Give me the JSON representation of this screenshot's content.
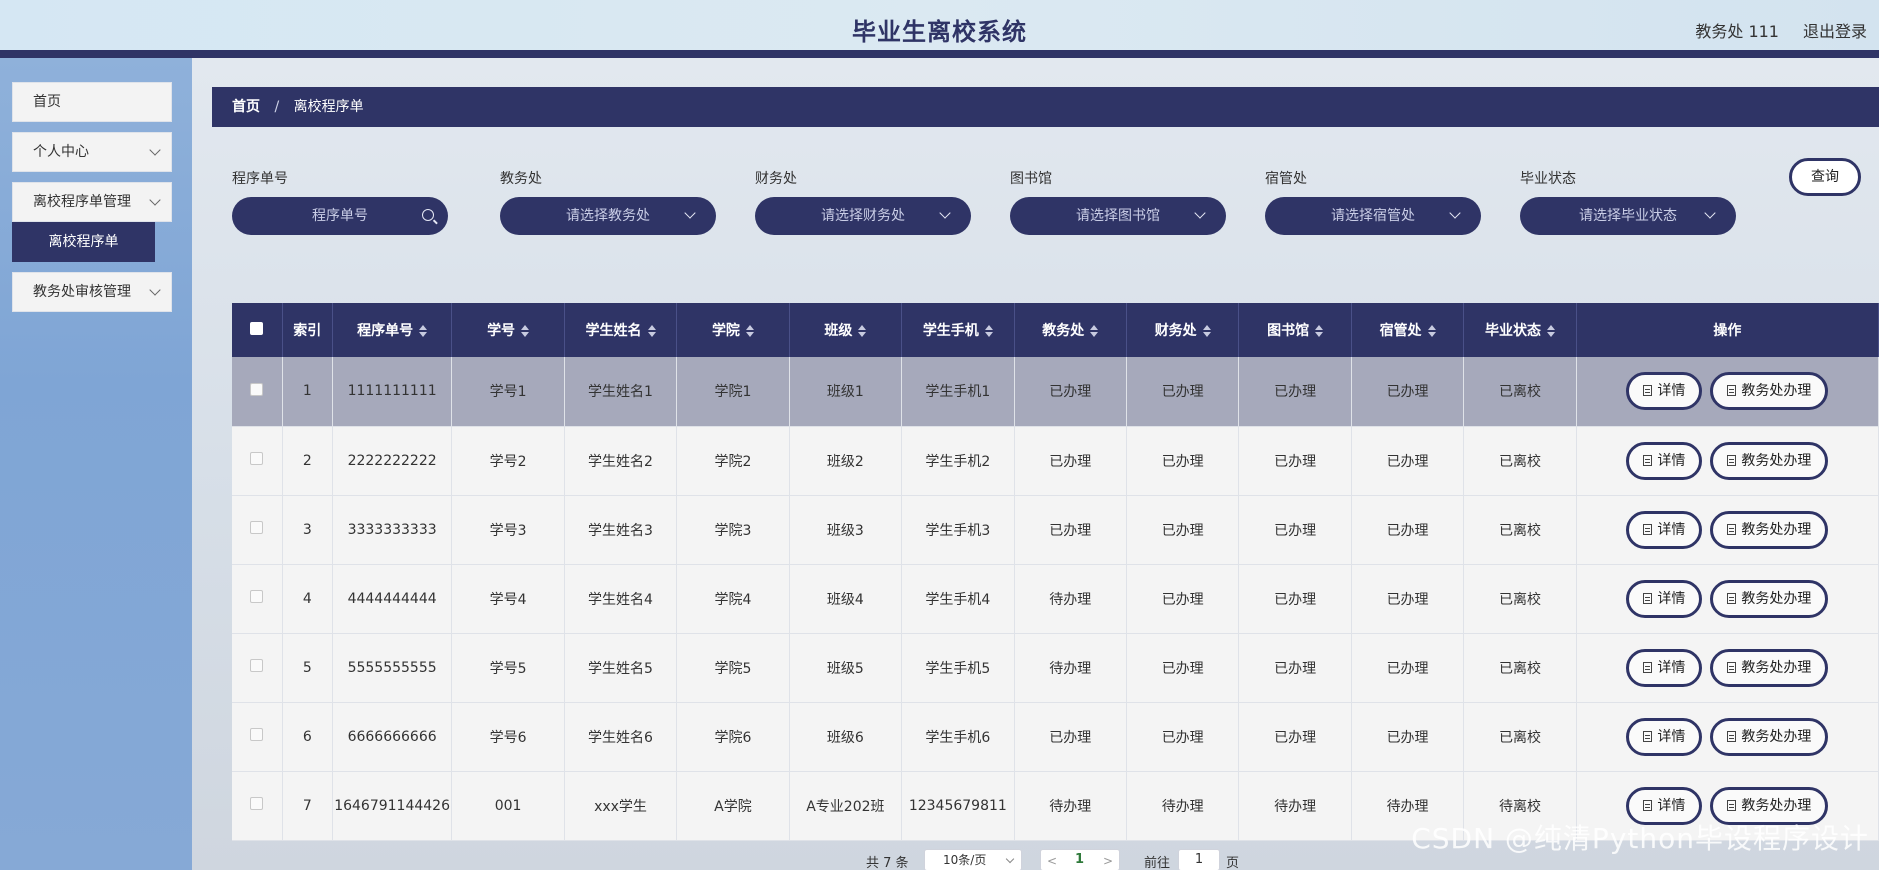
{
  "header": {
    "title": "毕业生离校系统",
    "user": "教务处 111",
    "logout": "退出登录"
  },
  "sidebar": {
    "items": [
      {
        "label": "首页"
      },
      {
        "label": "个人中心"
      },
      {
        "label": "离校程序单管理"
      },
      {
        "label": "教务处审核管理"
      }
    ],
    "submenu": {
      "label": "离校程序单"
    }
  },
  "breadcrumb": {
    "home": "首页",
    "sep": "/",
    "current": "离校程序单"
  },
  "filters": [
    {
      "label": "程序单号",
      "placeholder": "程序单号",
      "type": "input"
    },
    {
      "label": "教务处",
      "placeholder": "请选择教务处",
      "type": "select"
    },
    {
      "label": "财务处",
      "placeholder": "请选择财务处",
      "type": "select"
    },
    {
      "label": "图书馆",
      "placeholder": "请选择图书馆",
      "type": "select"
    },
    {
      "label": "宿管处",
      "placeholder": "请选择宿管处",
      "type": "select"
    },
    {
      "label": "毕业状态",
      "placeholder": "请选择毕业状态",
      "type": "select"
    }
  ],
  "query_button": "查询",
  "table": {
    "columns": [
      "索引",
      "程序单号",
      "学号",
      "学生姓名",
      "学院",
      "班级",
      "学生手机",
      "教务处",
      "财务处",
      "图书馆",
      "宿管处",
      "毕业状态",
      "操作"
    ],
    "rows": [
      [
        "1",
        "1111111111",
        "学号1",
        "学生姓名1",
        "学院1",
        "班级1",
        "学生手机1",
        "已办理",
        "已办理",
        "已办理",
        "已办理",
        "已离校"
      ],
      [
        "2",
        "2222222222",
        "学号2",
        "学生姓名2",
        "学院2",
        "班级2",
        "学生手机2",
        "已办理",
        "已办理",
        "已办理",
        "已办理",
        "已离校"
      ],
      [
        "3",
        "3333333333",
        "学号3",
        "学生姓名3",
        "学院3",
        "班级3",
        "学生手机3",
        "已办理",
        "已办理",
        "已办理",
        "已办理",
        "已离校"
      ],
      [
        "4",
        "4444444444",
        "学号4",
        "学生姓名4",
        "学院4",
        "班级4",
        "学生手机4",
        "待办理",
        "已办理",
        "已办理",
        "已办理",
        "已离校"
      ],
      [
        "5",
        "5555555555",
        "学号5",
        "学生姓名5",
        "学院5",
        "班级5",
        "学生手机5",
        "待办理",
        "已办理",
        "已办理",
        "已办理",
        "已离校"
      ],
      [
        "6",
        "6666666666",
        "学号6",
        "学生姓名6",
        "学院6",
        "班级6",
        "学生手机6",
        "已办理",
        "已办理",
        "已办理",
        "已办理",
        "已离校"
      ],
      [
        "7",
        "1646791144426",
        "001",
        "xxx学生",
        "A学院",
        "A专业202班",
        "12345679811",
        "待办理",
        "待办理",
        "待办理",
        "待办理",
        "待离校"
      ]
    ],
    "actions": {
      "detail": "详情",
      "process": "教务处办理"
    }
  },
  "pager": {
    "total": "共 7 条",
    "page_size": "10条/页",
    "prev": "<",
    "current": "1",
    "next": ">",
    "goto": "前往",
    "goto_value": "1",
    "page_unit": "页"
  },
  "watermark": "CSDN @纯清Python毕设程序设计"
}
